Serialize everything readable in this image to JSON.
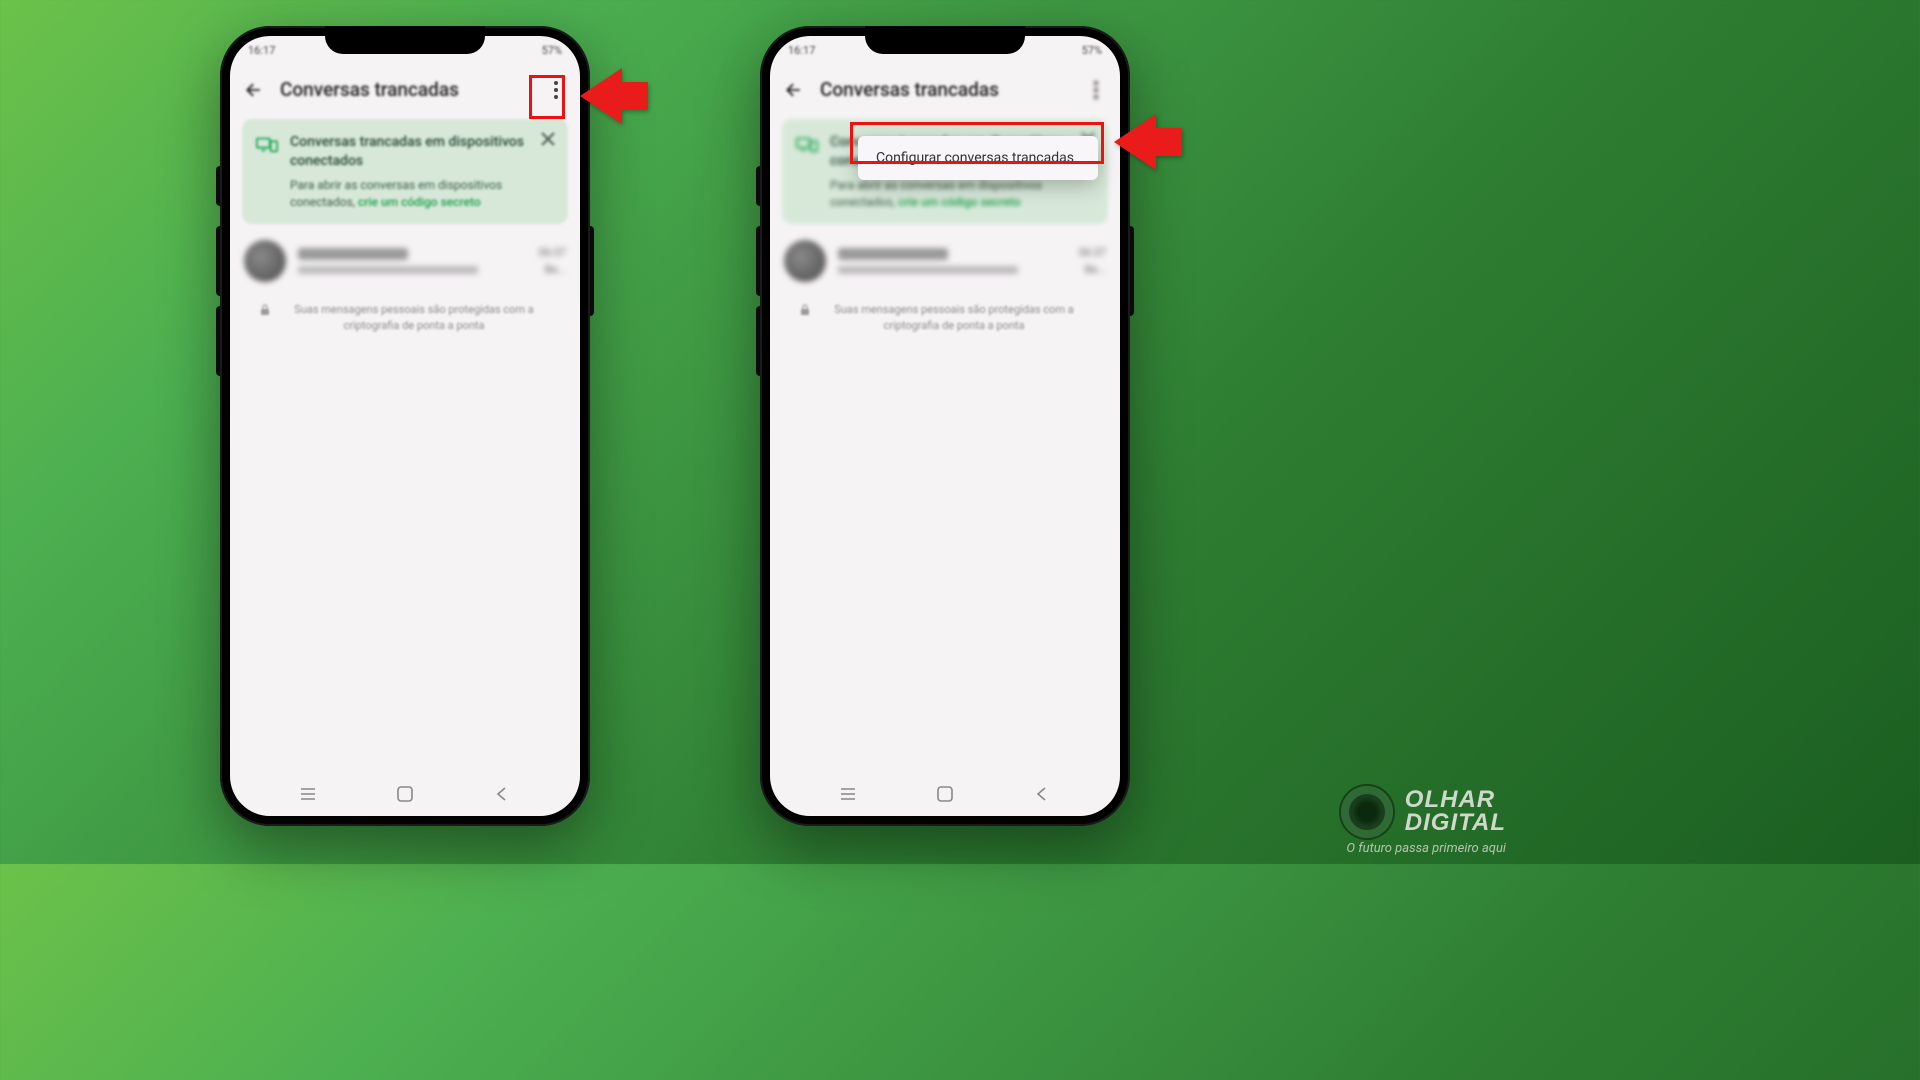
{
  "statusbar": {
    "time": "16:17",
    "battery": "57%"
  },
  "header": {
    "title": "Conversas trancadas"
  },
  "info_card": {
    "title": "Conversas trancadas em dispositivos conectados",
    "desc_prefix": "Para abrir as conversas em dispositivos conectados, ",
    "link": "crie um código secreto"
  },
  "chat": {
    "name": "",
    "preview": "",
    "time": "06:37",
    "suffix": "Be..."
  },
  "encryption": "Suas mensagens pessoais são protegidas com a criptografia de ponta a ponta",
  "dropdown": {
    "item": "Configurar conversas trancadas"
  },
  "brand": {
    "line1": "OLHAR",
    "line2": "DIGITAL",
    "tagline": "O futuro passa primeiro aqui"
  },
  "colors": {
    "accent_green": "#1fa855",
    "highlight_red": "#e11",
    "card_bg": "#d7e8d9"
  }
}
